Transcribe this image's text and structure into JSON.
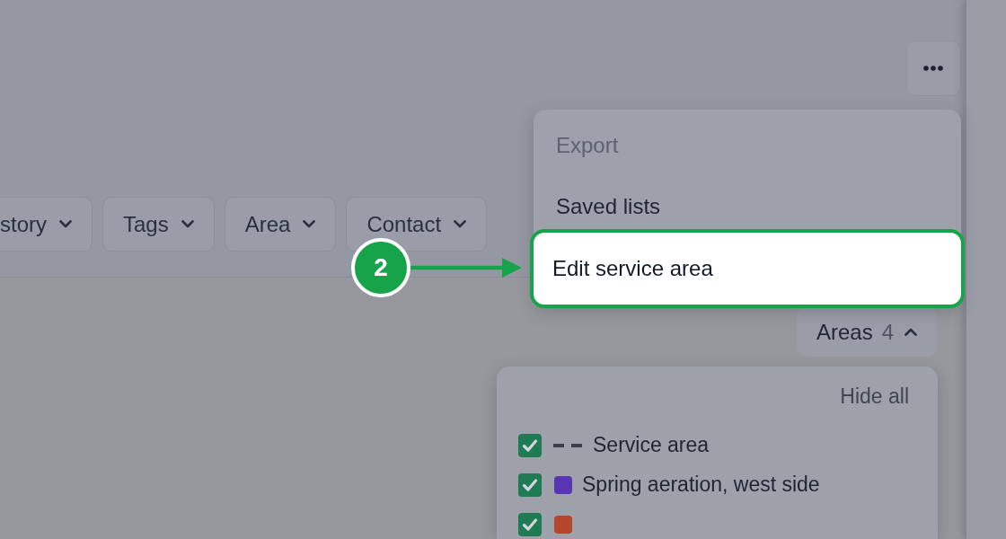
{
  "toolbar": {
    "filter_chips": [
      {
        "label": "story"
      },
      {
        "label": "Tags"
      },
      {
        "label": "Area"
      },
      {
        "label": "Contact"
      }
    ]
  },
  "more_menu": {
    "items": [
      {
        "label": "Export",
        "disabled": true,
        "spotlight": false
      },
      {
        "label": "Saved lists",
        "disabled": false,
        "spotlight": false
      },
      {
        "label": "Edit service area",
        "disabled": false,
        "spotlight": true
      }
    ]
  },
  "callout": {
    "step": "2"
  },
  "areas_button": {
    "label": "Areas",
    "count": "4",
    "expanded": true
  },
  "areas_panel": {
    "hide_all": "Hide all",
    "items": [
      {
        "kind": "line",
        "label": "Service area",
        "checked": true
      },
      {
        "kind": "swatch",
        "color": "#5a35b3",
        "label": "Spring aeration, west side",
        "checked": true
      },
      {
        "kind": "swatch",
        "color": "#b4472b",
        "checked": true
      }
    ]
  }
}
